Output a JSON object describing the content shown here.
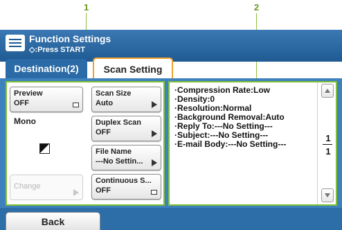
{
  "callouts": [
    "1",
    "2"
  ],
  "header": {
    "title": "Function Settings",
    "subtitle": "◇:Press START"
  },
  "tabs": [
    {
      "label": "Destination(2)",
      "selected": false
    },
    {
      "label": "Scan Setting",
      "selected": true
    }
  ],
  "left_panel": {
    "preview": {
      "label": "Preview",
      "value": "OFF"
    },
    "color_mode": "Mono",
    "change": {
      "label": "Change",
      "enabled": false
    },
    "scan_size": {
      "label": "Scan Size",
      "value": "Auto"
    },
    "duplex_scan": {
      "label": "Duplex Scan",
      "value": "OFF"
    },
    "file_name": {
      "label": "File Name",
      "value": "---No Settin..."
    },
    "continuous_scan": {
      "label": "Continuous S...",
      "value": "OFF"
    }
  },
  "right_panel": {
    "items": [
      "·Compression Rate:Low",
      "·Density:0",
      "·Resolution:Normal",
      "·Background Removal:Auto",
      "·Reply To:---No Setting---",
      "·Subject:---No Setting---",
      "·E-mail Body:---No Setting---"
    ],
    "page_current": "1",
    "page_total": "1"
  },
  "footer": {
    "back_label": "Back"
  },
  "colors": {
    "header_blue": "#2a6aa6",
    "workspace_blue": "#3e82bd",
    "panel_border_green": "#7fbf3a",
    "tab_highlight_orange": "#f0a22a"
  }
}
